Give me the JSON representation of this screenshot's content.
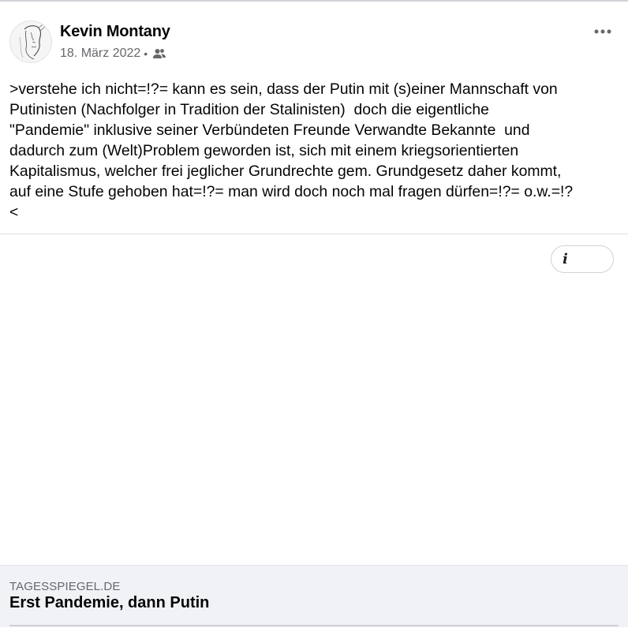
{
  "post": {
    "author": "Kevin Montany",
    "date": "18. März 2022",
    "separator": "•",
    "audience_icon": "friends-icon",
    "more_icon": "more-options-icon",
    "text": ">verstehe ich nicht=!?= kann es sein, dass der Putin mit (s)einer Mannschaft von\nPutinisten (Nachfolger in Tradition der Stalinisten)  doch die eigentliche\n\"Pandemie\" inklusive seiner Verbündeten Freunde Verwandte Bekannte  und\ndadurch zum (Welt)Problem geworden ist, sich mit einem kriegsorientierten\nKapitalismus, welcher frei jeglicher Grundrechte gem. Grundgesetz daher kommt,\nauf eine Stufe gehoben hat=!?= man wird doch noch mal fragen dürfen=!?= o.w.=!?\n<"
  },
  "info_button": {
    "glyph": "i"
  },
  "link_preview": {
    "domain": "TAGESSPIEGEL.DE",
    "title": "Erst Pandemie, dann Putin"
  },
  "colors": {
    "text": "#050505",
    "secondary": "#65676b",
    "card_background": "#f0f2f5"
  }
}
